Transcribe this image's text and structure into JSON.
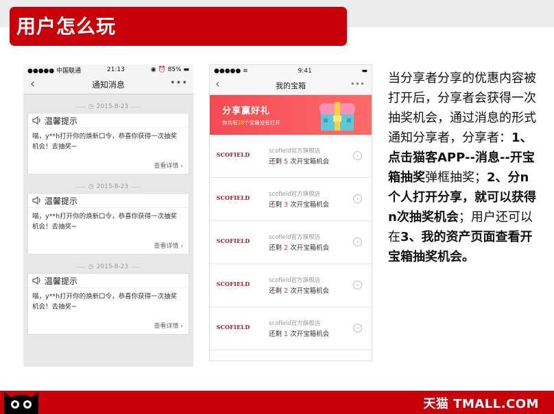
{
  "slide": {
    "title": "用户怎么玩",
    "brand": "天猫 TMALL.COM"
  },
  "phone1": {
    "status": {
      "carrier": "●●●●● 中国联通",
      "time": "21:13",
      "battery": "85%"
    },
    "nav_title": "通知消息",
    "messages": [
      {
        "date": "2015-8-23",
        "title": "温馨提示",
        "body": "喵，y**h打开你的焕新口令，恭喜你获得一次抽奖机会！去抽奖~",
        "link": "查看详情"
      },
      {
        "date": "2015-8-23",
        "title": "温馨提示",
        "body": "喵，y**h打开你的焕新口令，恭喜你获得一次抽奖机会！去抽奖~",
        "link": "查看详情"
      },
      {
        "date": "2015-8-23",
        "title": "温馨提示",
        "body": "喵，y**h打开你的焕新口令，恭喜你获得一次抽奖机会！去抽奖~",
        "link": "查看详情"
      }
    ]
  },
  "phone2": {
    "status": {
      "time": "9:41"
    },
    "nav_title": "我的宝箱",
    "banner": {
      "title": "分享赢好礼",
      "sub_pre": "你共有",
      "sub_count": "28",
      "sub_post": "个宝箱没有打开"
    },
    "shops": [
      {
        "logo": "SCOFIELD",
        "name": "scofield官方旗舰店",
        "pre": "还剩",
        "count": "5",
        "post": "次开宝箱机会"
      },
      {
        "logo": "SCOFIELD",
        "name": "scofield官方旗舰店",
        "pre": "还剩",
        "count": "3",
        "post": "次开宝箱机会"
      },
      {
        "logo": "SCOFIELD",
        "name": "scofield官方旗舰店",
        "pre": "还剩",
        "count": "2",
        "post": "次开宝箱机会"
      },
      {
        "logo": "SCOFIELD",
        "name": "scofield官方旗舰店",
        "pre": "还剩",
        "count": "2",
        "post": "次开宝箱机会"
      },
      {
        "logo": "SCOFIELD",
        "name": "scofield官方旗舰店",
        "pre": "还剩",
        "count": "1",
        "post": "次开宝箱机会"
      }
    ]
  },
  "description": {
    "t1": "当分享者分享的优惠内容被打开后，分享者会获得一次抽奖机会，通过消息的形式通知分享者，分享者：",
    "b1": "1、点击猫客APP--消息--开宝箱抽奖",
    "t2": "弹框抽奖；",
    "b2": "2、分n个人打开分享，就可以获得n次抽奖机会",
    "t3": "；用户还可以在",
    "b3": "3、我的资产页面查看开宝箱抽奖机会。"
  },
  "colors": {
    "brand_red": "#c8000a",
    "banner_red": "#f34a52",
    "count_red": "#f23030"
  }
}
